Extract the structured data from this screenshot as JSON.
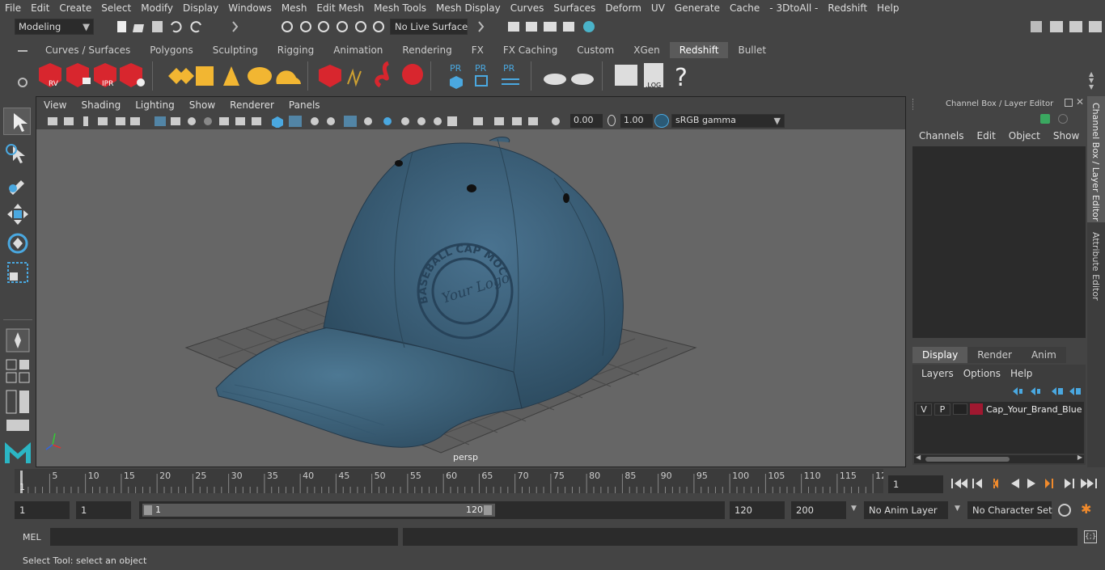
{
  "menu": [
    "File",
    "Edit",
    "Create",
    "Select",
    "Modify",
    "Display",
    "Windows",
    "Mesh",
    "Edit Mesh",
    "Mesh Tools",
    "Mesh Display",
    "Curves",
    "Surfaces",
    "Deform",
    "UV",
    "Generate",
    "Cache",
    "- 3DtoAll -",
    "Redshift",
    "Help"
  ],
  "workspace_mode": "Modeling",
  "live_surface": "No Live Surface",
  "shelf_tabs": [
    "Curves / Surfaces",
    "Polygons",
    "Sculpting",
    "Rigging",
    "Animation",
    "Rendering",
    "FX",
    "FX Caching",
    "Custom",
    "XGen",
    "Redshift",
    "Bullet"
  ],
  "active_shelf_tab": "Redshift",
  "shelf_icon_labels": {
    "rv": "RV",
    "ipr": "IPR",
    "pr1": "PR",
    "pr2": "PR",
    "pr3": "PR",
    "log": ".LOG",
    "help": "?"
  },
  "viewport": {
    "menu": [
      "View",
      "Shading",
      "Lighting",
      "Show",
      "Renderer",
      "Panels"
    ],
    "exposure": "0.00",
    "gamma": "1.00",
    "color_space": "sRGB gamma",
    "camera_label": "persp",
    "logo_text_top": "BASEBALL CAP MOCKUP",
    "logo_text_center": "Your Logo"
  },
  "channel_box": {
    "title": "Channel Box / Layer Editor",
    "menu": [
      "Channels",
      "Edit",
      "Object",
      "Show"
    ]
  },
  "layer_editor": {
    "tabs": [
      "Display",
      "Render",
      "Anim"
    ],
    "active_tab": "Display",
    "menu": [
      "Layers",
      "Options",
      "Help"
    ],
    "layer": {
      "v": "V",
      "p": "P",
      "name": "Cap_Your_Brand_Blue",
      "color": "#a01830"
    }
  },
  "side_tabs": [
    "Channel Box / Layer Editor",
    "Attribute Editor"
  ],
  "timeline": {
    "ticks": [
      "5",
      "10",
      "15",
      "20",
      "25",
      "30",
      "35",
      "40",
      "45",
      "50",
      "55",
      "60",
      "65",
      "70",
      "75",
      "80",
      "85",
      "90",
      "95",
      "100",
      "105",
      "110",
      "115",
      "12"
    ],
    "start_label": "1",
    "current_frame": "1"
  },
  "range": {
    "start": "1",
    "playback_start": "1",
    "slider_start": "1",
    "slider_end": "120",
    "playback_end": "120",
    "end": "200",
    "anim_layer": "No Anim Layer",
    "character_set": "No Character Set"
  },
  "command_line": {
    "label": "MEL"
  },
  "status": "Select Tool: select an object",
  "colors": {
    "accent": "#5285a6",
    "cap": "#3d6078",
    "redshift_red": "#d8262e",
    "maya_teal": "#2bb6c4"
  }
}
